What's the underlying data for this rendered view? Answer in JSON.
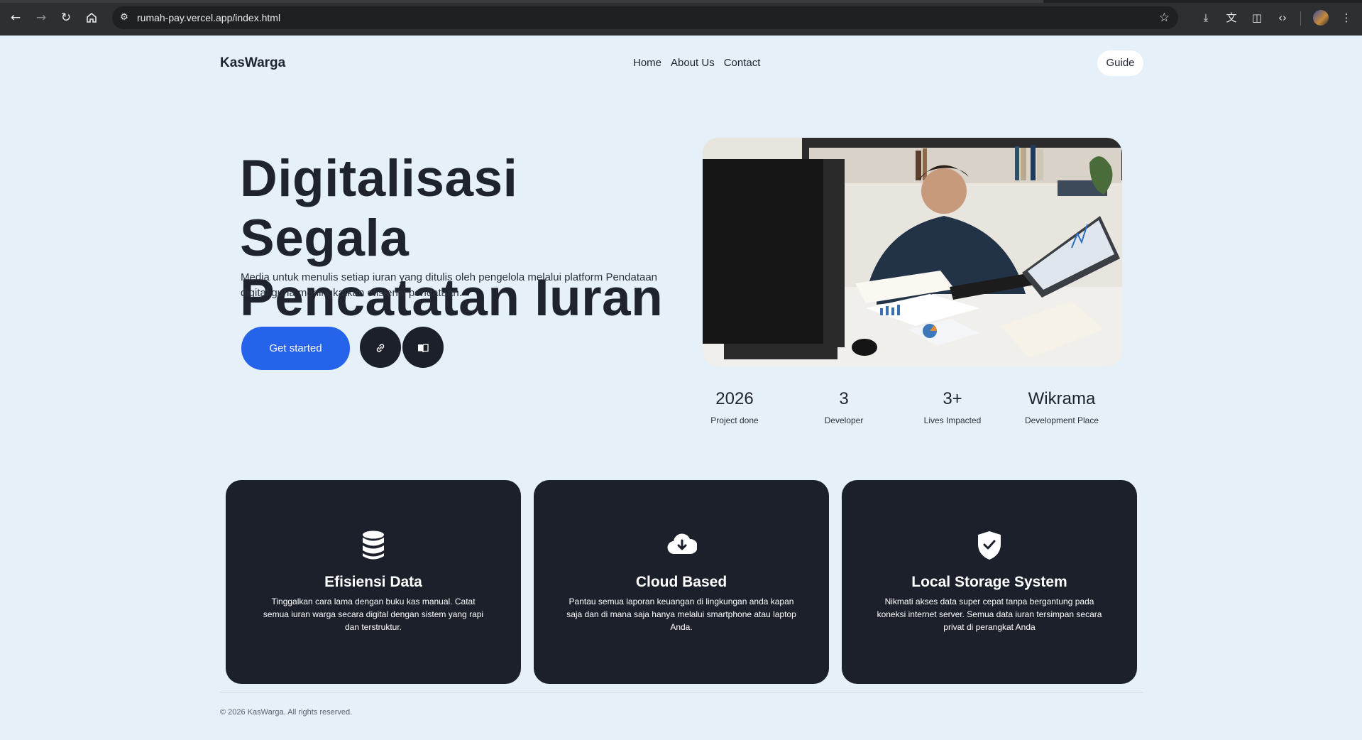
{
  "browser": {
    "url": "rumah-pay.vercel.app/index.html",
    "icons": [
      "back-icon",
      "forward-icon",
      "reload-icon",
      "home-icon",
      "site-info-icon",
      "bookmark-star-icon",
      "download-icon",
      "translate-icon",
      "sidebar-icon",
      "devtools-icon",
      "profile-avatar",
      "menu-icon"
    ]
  },
  "header": {
    "brand": "KasWarga",
    "nav": [
      "Home",
      "About Us",
      "Contact"
    ],
    "guide_label": "Guide"
  },
  "hero": {
    "title_bold": "Digitalisasi",
    "title_rest": " Segala Pencatatan Iuran",
    "description": "Media untuk menulis setiap iuran yang ditulis oleh pengelola melalui platform Pendataan digital guna meningkatkan efisiensi pendataan.",
    "cta_label": "Get started",
    "icon_buttons": [
      "link-icon",
      "book-icon"
    ],
    "image": "man-writing-at-desk-photo"
  },
  "stats": [
    {
      "value": "2026",
      "label": "Project done"
    },
    {
      "value": "3",
      "label": "Developer"
    },
    {
      "value": "3+",
      "label": "Lives Impacted"
    },
    {
      "value": "Wikrama",
      "label": "Development Place"
    }
  ],
  "features": [
    {
      "icon": "database-icon",
      "title": "Efisiensi Data",
      "description": "Tinggalkan cara lama dengan buku kas manual. Catat semua iuran warga secara digital dengan sistem yang rapi dan terstruktur."
    },
    {
      "icon": "cloud-download-icon",
      "title": "Cloud Based",
      "description": "Pantau semua laporan keuangan di lingkungan anda kapan saja dan di mana saja hanya melalui smartphone atau laptop Anda."
    },
    {
      "icon": "shield-check-icon",
      "title": "Local Storage System",
      "description": "Nikmati akses data super cepat tanpa bergantung pada koneksi internet server. Semua data iuran tersimpan secara privat di perangkat Anda"
    }
  ],
  "footer": {
    "copyright": "© 2026 KasWarga. All rights reserved."
  },
  "colors": {
    "page_bg": "#e6f0f9",
    "primary": "#2563eb",
    "dark": "#1b202b"
  }
}
